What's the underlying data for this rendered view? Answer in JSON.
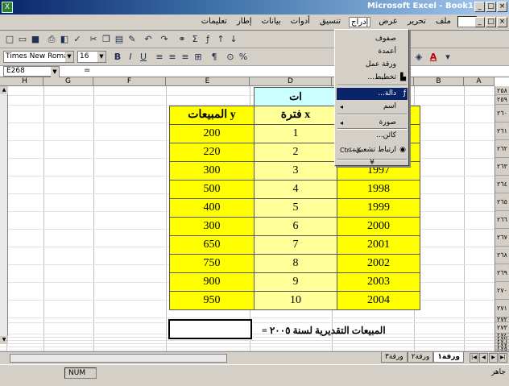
{
  "window": {
    "title": "Microsoft Excel - Book1"
  },
  "menubar": {
    "items": [
      "ملف",
      "تحرير",
      "عرض",
      "إدراج",
      "تنسيق",
      "أدوات",
      "بيانات",
      "إطار",
      "تعليمات"
    ],
    "active_index": 3
  },
  "toolbar": {
    "font_name": "Times New Roman",
    "font_size": "16",
    "buttons": [
      "new",
      "open",
      "save",
      "print",
      "preview",
      "spell",
      "cut",
      "copy",
      "paste",
      "format-painter",
      "undo",
      "redo",
      "hyperlink",
      "autosum",
      "function",
      "sort-asc",
      "sort-desc"
    ],
    "format_buttons": [
      "B",
      "I",
      "U",
      "align-left",
      "center",
      "align-right",
      "merge",
      "percent",
      "currency"
    ]
  },
  "formula_bar": {
    "name_box": "E268",
    "equals": "="
  },
  "columns": [
    "A",
    "B",
    "C",
    "D",
    "E",
    "F",
    "G",
    "H"
  ],
  "row_numbers": [
    "٢٥٨",
    "٢٥٩",
    "٢٦٠",
    "٢٦١",
    "٢٦٢",
    "٢٦٣",
    "٢٦٤",
    "٢٦٥",
    "٢٦٦",
    "٢٦٧",
    "٢٦٨",
    "٢٦٩",
    "٢٧٠",
    "٢٧١",
    "٢٧٢",
    "٢٧٣",
    "٢٧٤",
    "٢٧٥",
    "٢٧٦",
    "٢٧٧",
    "٢٧٨",
    "٢٧٩"
  ],
  "table": {
    "title_fragment": "ات",
    "header_e": "المبيعات y",
    "header_d": "فترة x",
    "rows": [
      {
        "sales": "200",
        "x": "1",
        "year": ""
      },
      {
        "sales": "220",
        "x": "2",
        "year": ""
      },
      {
        "sales": "300",
        "x": "3",
        "year": "1997"
      },
      {
        "sales": "500",
        "x": "4",
        "year": "1998"
      },
      {
        "sales": "400",
        "x": "5",
        "year": "1999"
      },
      {
        "sales": "300",
        "x": "6",
        "year": "2000"
      },
      {
        "sales": "650",
        "x": "7",
        "year": "2001"
      },
      {
        "sales": "750",
        "x": "8",
        "year": "2002"
      },
      {
        "sales": "900",
        "x": "9",
        "year": "2003"
      },
      {
        "sales": "950",
        "x": "10",
        "year": "2004"
      }
    ]
  },
  "estimate_label": "المبيعات التقديرية لسنة ٢٠٠٥ =",
  "insert_menu": {
    "items": [
      {
        "label": "صفوف",
        "shortcut": "",
        "icon": ""
      },
      {
        "label": "أعمدة",
        "shortcut": "",
        "icon": ""
      },
      {
        "label": "ورقة عمل",
        "shortcut": "",
        "icon": ""
      },
      {
        "label": "تخطيط...",
        "shortcut": "",
        "icon": "chart-icon"
      },
      {
        "label": "دالة...",
        "shortcut": "",
        "icon": "function-icon",
        "highlighted": true
      },
      {
        "label": "اسم",
        "shortcut": "",
        "icon": "",
        "submenu": true
      },
      {
        "label": "صورة",
        "shortcut": "",
        "icon": "",
        "submenu": true
      },
      {
        "label": "كائن...",
        "shortcut": "",
        "icon": ""
      },
      {
        "label": "ارتباط تشعبي...",
        "shortcut": "Ctrl+K",
        "icon": "hyperlink-icon"
      }
    ],
    "more": "¥"
  },
  "sheet_tabs": [
    "ورقة١",
    "ورقة٢",
    "ورقة٣"
  ],
  "active_tab": 0,
  "status": {
    "ready": "جاهز",
    "num": "NUM"
  }
}
